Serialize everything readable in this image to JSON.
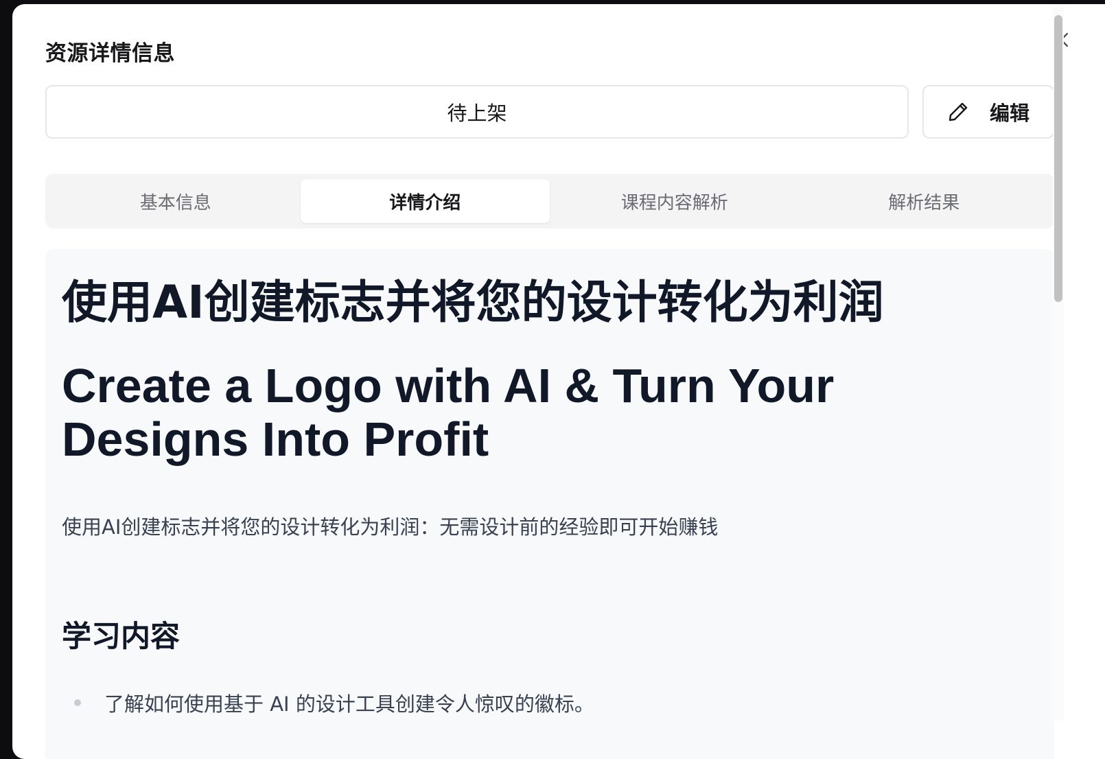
{
  "modal": {
    "title": "资源详情信息",
    "close_icon": "close-icon"
  },
  "status": {
    "value": "待上架"
  },
  "edit_button": {
    "label": "编辑",
    "icon": "pencil-icon"
  },
  "tabs": [
    {
      "label": "基本信息",
      "active": false
    },
    {
      "label": "详情介绍",
      "active": true
    },
    {
      "label": "课程内容解析",
      "active": false
    },
    {
      "label": "解析结果",
      "active": false
    }
  ],
  "content": {
    "title_cn": "使用AI创建标志并将您的设计转化为利润",
    "title_en": "Create a Logo with AI & Turn Your Designs Into Profit",
    "description": "使用AI创建标志并将您的设计转化为利润：无需设计前的经验即可开始赚钱",
    "section_heading": "学习内容",
    "bullets": [
      "了解如何使用基于 AI 的设计工具创建令人惊叹的徽标。"
    ]
  },
  "colors": {
    "backdrop": "#0d0d0f",
    "modal_bg": "#ffffff",
    "content_bg": "#f8f9fb",
    "tab_bar_bg": "#f4f4f5",
    "border": "#e5e7eb",
    "text_primary": "#111827"
  }
}
